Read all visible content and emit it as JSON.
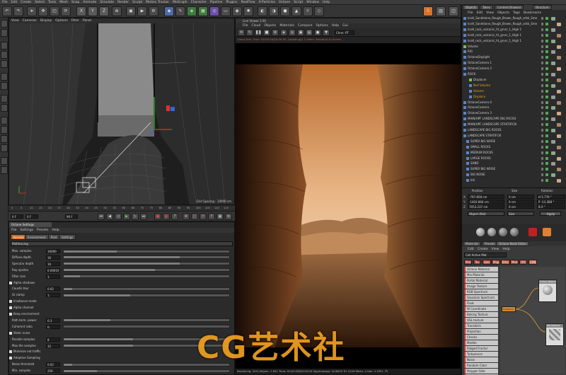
{
  "menubar": [
    "File",
    "Edit",
    "Create",
    "Select",
    "Tools",
    "Mesh",
    "Snap",
    "Animate",
    "Simulate",
    "Render",
    "Sculpt",
    "Motion Tracker",
    "MoGraph",
    "Character",
    "Pipeline",
    "Plugins",
    "RealFlow",
    "X-Particles",
    "Octane",
    "Script",
    "Window",
    "Help"
  ],
  "axis_buttons": [
    "X",
    "Y",
    "Z"
  ],
  "viewport": {
    "title": "Perspective",
    "menu": [
      "View",
      "Cameras",
      "Display",
      "Options",
      "Filter",
      "Panel"
    ],
    "grid_spacing": "Grid Spacing : 10000 cm",
    "ruler": [
      "0",
      "5",
      "10",
      "15",
      "20",
      "25",
      "30",
      "35",
      "40",
      "45",
      "50",
      "55",
      "60",
      "65",
      "70",
      "75",
      "80",
      "85",
      "90",
      "95",
      "100",
      "105",
      "110",
      "115"
    ],
    "frame_start": "0 F",
    "frame_current": "0 F",
    "frame_end": "90 F"
  },
  "octane_settings": {
    "title": "Octane Settings",
    "menu": [
      "File",
      "Settings",
      "Presets",
      "Help"
    ],
    "tabs": [
      "Kernels",
      "Environment",
      "Post",
      "Settings"
    ],
    "mode": "Pathtracing",
    "rows": [
      {
        "label": "Max. samples",
        "value": "16000",
        "fill": 0.32
      },
      {
        "label": "Diffuse depth",
        "value": "16",
        "fill": 0.7
      },
      {
        "label": "Specular depth",
        "value": "16",
        "fill": 0.7
      },
      {
        "label": "Ray epsilon",
        "value": "0.00010",
        "fill": 0.55
      },
      {
        "label": "Filter size",
        "value": "1.",
        "fill": 0.1
      },
      {
        "label": "Alpha shadows",
        "value": ""
      },
      {
        "label": "Caustic blur",
        "value": "0.02",
        "fill": 0.05
      },
      {
        "label": "GI clamp",
        "value": "1.",
        "fill": 0.4
      },
      {
        "label": "Irradiance mode",
        "value": ""
      },
      {
        "label": "Alpha channel",
        "value": ""
      },
      {
        "label": "Keep environment",
        "value": ""
      },
      {
        "label": "Path term. power",
        "value": "0.3",
        "fill": 0.28
      },
      {
        "label": "Coherent ratio",
        "value": "0.",
        "fill": 0.0
      },
      {
        "label": "Static noise",
        "value": ""
      },
      {
        "label": "Parallel samples",
        "value": "8",
        "fill": 0.42
      },
      {
        "label": "Max tile samples",
        "value": "32",
        "fill": 0.42
      },
      {
        "label": "Minimize net traffic",
        "value": ""
      },
      {
        "label": "Adaptive Sampling",
        "value": ""
      },
      {
        "label": "Noise threshold",
        "value": "0.02",
        "fill": 0.05
      },
      {
        "label": "Min. samples",
        "value": "256",
        "fill": 0.2
      }
    ]
  },
  "live_viewer": {
    "title": "Live Viewer 2.91",
    "menu": [
      "File",
      "Cloud",
      "Objects",
      "Materials",
      "Compare",
      "Options",
      "Help",
      "Gui"
    ],
    "channel": "Chnn: PT",
    "status": "Check this: Time: 00:00:56/00:00:00, Updating(0.7) Mem: Render(0.0) Scene: ...",
    "bottom_status": "Rendering: 54%   Ms/sec: 1.851   Time: 00:00:56/00:00:00   Spp/maxspp: 5/16000   Tri: 0/1M   Mesh: 4   Hair: 0   GPU: 75"
  },
  "object_manager": {
    "tabs": [
      "Objects",
      "Takes",
      "Content Browser",
      "Structure"
    ],
    "menu": [
      "File",
      "Edit",
      "View",
      "Objects",
      "Tags",
      "Bookmarks"
    ],
    "items": [
      "kcell_Sandstone_Rough_Brown_Rough_sdsk_Sme",
      "kcell_Sandstone_Rough_Brown_Rough_sdsk_Sme",
      "kcell_rock_volcanic_ht_grvsr_1_High 1",
      "kcell_rock_volcanic_ht_grvsr_1_High 1",
      "kcell_rock_volcanic_ht_grvsr_1_High 1",
      "Volume",
      "RIG",
      "OctaneDaylight",
      "OctaneCamera 1",
      "OctaneCamera 2",
      "ROCK",
      "Displacer",
      "Null Volume",
      "Volume",
      "Displace",
      "OctaneCamera 4",
      "OctaneCamera",
      "OctaneCamera 3",
      "MAIN/HPF LANDSCAPE BIG ROCKS",
      "MAIN/HPF LANDSCAPE STRATIFICN",
      "LANDSCAPE BIG ROCKS",
      "LANDSCAPE STRATIFCN",
      "SUPER BIG NOISE",
      "SMALL ROCKS",
      "MEDIUM ROCKS",
      "LARGE ROCKS",
      "SAND",
      "SUPER BIG NOISE",
      "BIG NOISE",
      "bill"
    ]
  },
  "coordinates": {
    "headers": [
      "Position",
      "Size",
      "Rotation"
    ],
    "rows": [
      {
        "axis": "X",
        "pos": "-797.858 cm",
        "size": "0 cm",
        "rot": "H  5.776 °"
      },
      {
        "axis": "Y",
        "pos": "-1402.864 cm",
        "size": "0 cm",
        "rot": "P  -13.388 °"
      },
      {
        "axis": "Z",
        "pos": "7053.237 cm",
        "size": "0 cm",
        "rot": "B  0 °"
      }
    ],
    "mode": "Object (Rel)",
    "size_mode": "Size",
    "apply": "Apply"
  },
  "node_editor": {
    "tabs": [
      "Materials",
      "Presets",
      "Octane Node Editor"
    ],
    "menu": [
      "Edit",
      "Create",
      "View",
      "Help"
    ],
    "search": "Cell Active Mat",
    "filters": [
      "Mat",
      "Tex",
      "Gen",
      "Map",
      "Ems",
      "Med",
      "Oth",
      "C4D"
    ],
    "nodes": [
      "Octane Material",
      "Mix Material",
      "Portal Material",
      "Image Texture",
      "RGB Spectrum",
      "Gaussian Spectrum",
      "Float",
      "W Coordinate",
      "Baking Texture",
      "OSL texture",
      "Transform",
      "Projection",
      "Checks",
      "Marble",
      "Ridged Fractal",
      "Turbulence",
      "Noise",
      "Random Color",
      "Polygon Side",
      "Instance Range"
    ],
    "labels": {
      "material": "Octane Material",
      "transform": "Transform",
      "mix": "Mix Material"
    }
  },
  "watermark": "CG艺术社"
}
